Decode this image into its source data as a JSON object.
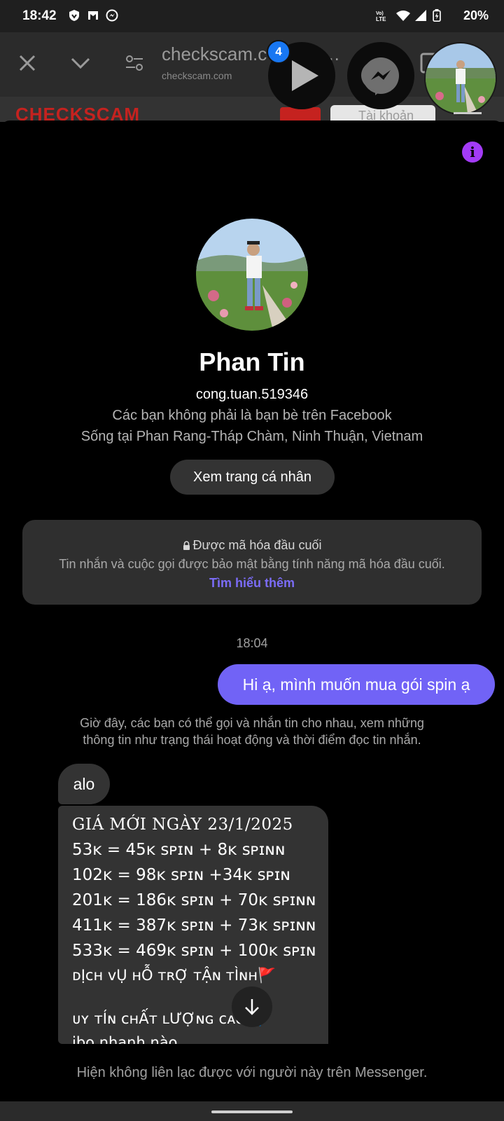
{
  "status_bar": {
    "time": "18:42",
    "battery": "20%",
    "icons": [
      "vpn-shield-icon",
      "gmail-icon",
      "messenger-notif-icon",
      "volte-icon",
      "wifi-icon",
      "signal-icon",
      "battery-icon"
    ]
  },
  "browser": {
    "url_title": "checkscam.c",
    "url_domain": "checkscam.com",
    "site_logo": "CHECKSCAM",
    "search_placeholder": "Tài khoản"
  },
  "chatheads": {
    "badge_count": "4"
  },
  "profile": {
    "name": "Phan Tin",
    "username": "cong.tuan.519346",
    "friend_status": "Các bạn không phải là bạn bè trên Facebook",
    "location": "Sống tại Phan Rang-Tháp Chàm, Ninh Thuận, Vietnam",
    "view_profile_label": "Xem trang cá nhân"
  },
  "encryption": {
    "title": "Được mã hóa đầu cuối",
    "body": "Tin nhắn và cuộc gọi được bảo mật bằng tính năng mã hóa đầu cuối.",
    "learn_more": "Tìm hiểu thêm"
  },
  "chat": {
    "timestamp": "18:04",
    "sent_message": "Hi ạ, mình muốn mua gói spin ạ",
    "notice": "Giờ đây, các bạn có thể gọi và nhắn tin cho nhau, xem những thông tin như trạng thái hoạt động và thời điểm đọc tin nhắn.",
    "received_short": "alo",
    "received_lines": [
      "GIÁ MỚI NGÀY 23/1/2025",
      "53ᴋ   = 45ᴋ ꜱᴘɪɴ +  8ᴋ ꜱᴘɪɴɴ",
      "102ᴋ   = 98ᴋ ꜱᴘɪɴ  +34ᴋ ꜱᴘɪɴ",
      "201ᴋ   = 186ᴋ ꜱᴘɪɴ + 70ᴋ ꜱᴘɪɴɴ",
      "411ᴋ  = 387ᴋ ꜱᴘɪɴ + 73ᴋ ꜱᴘɪɴɴ",
      "533ᴋ   = 469ᴋ ꜱᴘɪɴ + 100ᴋ ꜱᴘɪɴ",
      "ᴅỊᴄʜ ᴠỤ ʜỖ ᴛʀỢ ᴛẬɴ ᴛÌɴʜ🚩",
      "",
      "ᴜʏ ᴛÍɴ ᴄʜẤᴛ ʟƯỢɴɢ ᴄᴀᴏ✈️",
      "ibo nhanh nào"
    ],
    "unreachable": "Hiện không liên lạc được với người này trên Messenger."
  },
  "colors": {
    "sent_bubble": "#7163f6",
    "received_bubble": "#333333",
    "info_icon": "#a33bf6",
    "badge": "#1877f2",
    "link": "#7b6cf7"
  }
}
